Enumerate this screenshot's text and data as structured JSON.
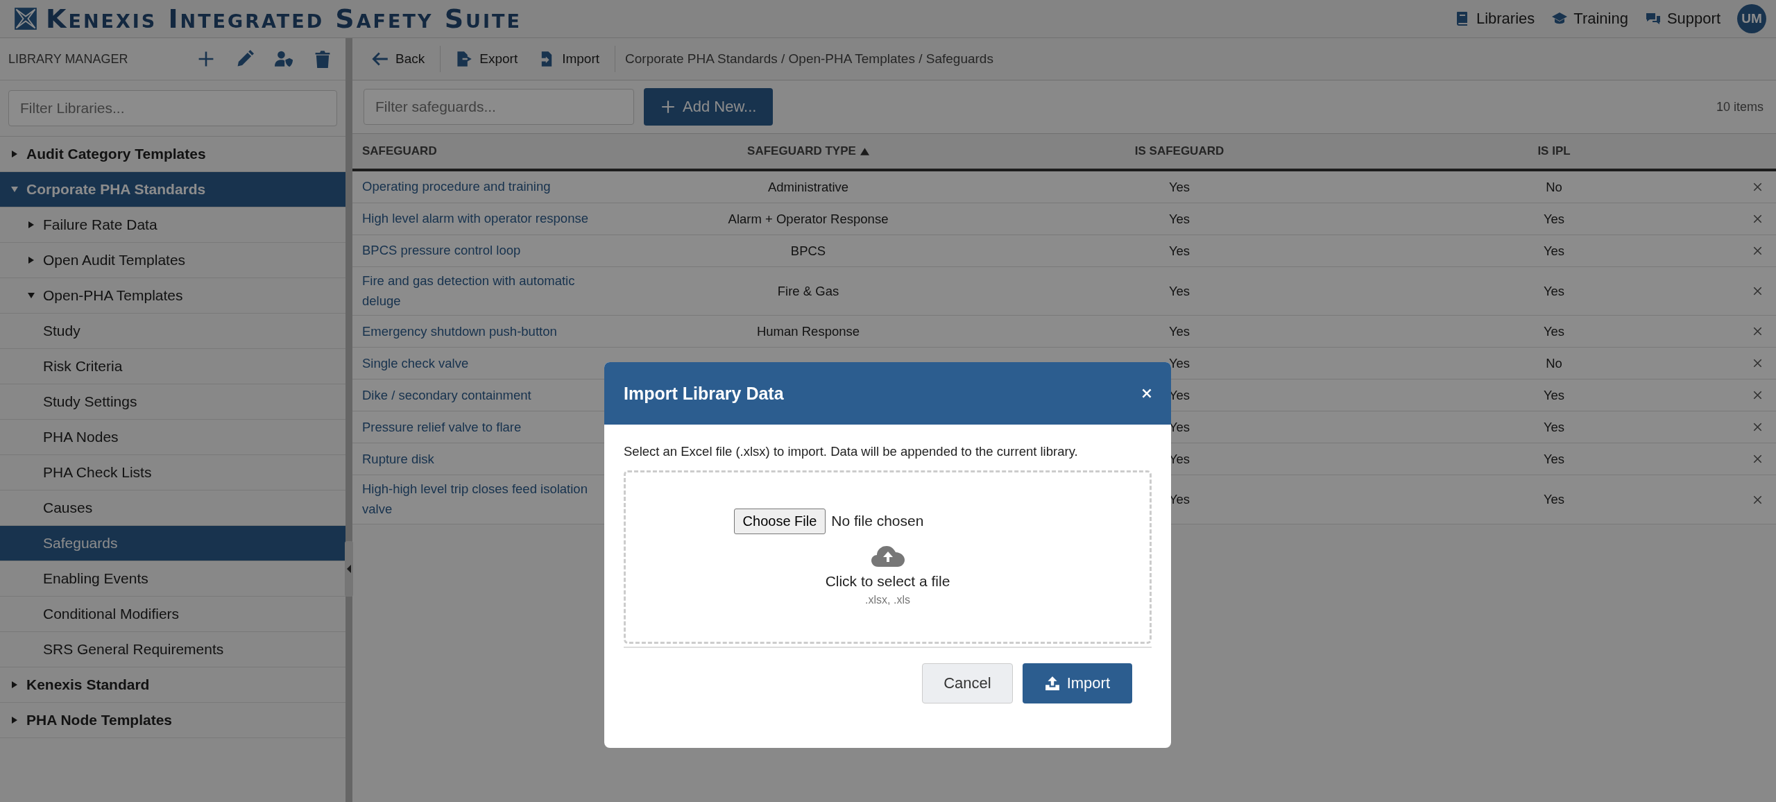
{
  "app": {
    "title": "Kenexis Integrated Safety Suite"
  },
  "nav_links": [
    {
      "label": "Libraries",
      "kind": "book"
    },
    {
      "label": "Training",
      "kind": "cap"
    },
    {
      "label": "Support",
      "kind": "chat"
    }
  ],
  "user_avatar": {
    "initials": "UM"
  },
  "sidebar": {
    "title": "LIBRARY MANAGER",
    "filter": {
      "placeholder": "Filter Libraries..."
    },
    "tree": [
      {
        "label": "Audit Category Templates",
        "expanded": false,
        "selected": false
      },
      {
        "label": "Corporate PHA Standards",
        "expanded": true,
        "selected": true,
        "children": [
          {
            "label": "Failure Rate Data",
            "expanded": false,
            "selected": false
          },
          {
            "label": "Open Audit Templates",
            "expanded": false,
            "selected": false
          },
          {
            "label": "Open-PHA Templates",
            "expanded": true,
            "selected": false,
            "children": [
              {
                "label": "Study",
                "selected": false
              },
              {
                "label": "Risk Criteria",
                "selected": false
              },
              {
                "label": "Study Settings",
                "selected": false
              },
              {
                "label": "PHA Nodes",
                "selected": false
              },
              {
                "label": "PHA Check Lists",
                "selected": false
              },
              {
                "label": "Causes",
                "selected": false
              },
              {
                "label": "Safeguards",
                "selected": true
              },
              {
                "label": "Enabling Events",
                "selected": false
              },
              {
                "label": "Conditional Modifiers",
                "selected": false
              },
              {
                "label": "SRS General Requirements",
                "selected": false
              }
            ]
          }
        ]
      },
      {
        "label": "Kenexis Standard",
        "expanded": false,
        "selected": false
      },
      {
        "label": "PHA Node Templates",
        "expanded": false,
        "selected": false
      }
    ]
  },
  "toolbar": {
    "back": "Back",
    "export": "Export",
    "import": "Import",
    "breadcrumb": "Corporate PHA Standards / Open-PHA Templates / Safeguards"
  },
  "filter": {
    "placeholder": "Filter safeguards..."
  },
  "add_button": "Add New...",
  "item_count": "10 items",
  "table": {
    "columns": [
      {
        "label": "SAFEGUARD",
        "sorted": false
      },
      {
        "label": "SAFEGUARD TYPE",
        "sorted": true
      },
      {
        "label": "IS SAFEGUARD",
        "sorted": false
      },
      {
        "label": "IS IPL",
        "sorted": false
      }
    ],
    "rows": [
      {
        "safeguard": "Operating procedure and training",
        "type": "Administrative",
        "is_safeguard": "Yes",
        "is_ipl": "No"
      },
      {
        "safeguard": "High level alarm with operator response",
        "type": "Alarm + Operator Response",
        "is_safeguard": "Yes",
        "is_ipl": "Yes"
      },
      {
        "safeguard": "BPCS pressure control loop",
        "type": "BPCS",
        "is_safeguard": "Yes",
        "is_ipl": "Yes"
      },
      {
        "safeguard": "Fire and gas detection with automatic deluge",
        "type": "Fire & Gas",
        "is_safeguard": "Yes",
        "is_ipl": "Yes"
      },
      {
        "safeguard": "Emergency shutdown push-button",
        "type": "Human Response",
        "is_safeguard": "Yes",
        "is_ipl": "Yes"
      },
      {
        "safeguard": "Single check valve",
        "is_safeguard": "Yes",
        "is_ipl": "No"
      },
      {
        "safeguard": "Dike / secondary containment",
        "is_safeguard": "Yes",
        "is_ipl": "Yes"
      },
      {
        "safeguard": "Pressure relief valve to flare",
        "is_safeguard": "Yes",
        "is_ipl": "Yes"
      },
      {
        "safeguard": "Rupture disk",
        "is_safeguard": "Yes",
        "is_ipl": "Yes"
      },
      {
        "safeguard": "High-high level trip closes feed isolation valve",
        "is_safeguard": "Yes",
        "is_ipl": "Yes"
      }
    ]
  },
  "modal": {
    "title": "Import Library Data",
    "message": "Select an Excel file (.xlsx) to import. Data will be appended to the current library.",
    "choose_file": "Choose File",
    "file_status": "No file chosen",
    "drop_text": "Click to select a file",
    "formats": ".xlsx, .xls",
    "cancel": "Cancel",
    "import": "Import"
  }
}
